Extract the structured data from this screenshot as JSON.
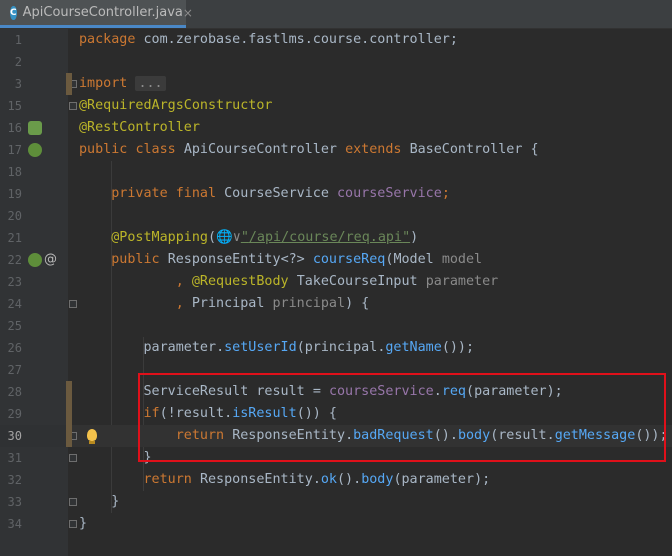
{
  "tab": {
    "icon_letter": "C",
    "file_name": "ApiCourseController.java",
    "close_symbol": "×"
  },
  "lines": [
    {
      "num": "1",
      "tokens": [
        {
          "t": "package ",
          "c": "kw"
        },
        {
          "t": "com.zerobase.fastlms.course.controller;",
          "c": "plain"
        }
      ]
    },
    {
      "num": "2",
      "tokens": []
    },
    {
      "num": "3",
      "tokens": [
        {
          "t": "import ",
          "c": "kw"
        },
        {
          "t": "...",
          "c": "fold-collapsed"
        }
      ]
    },
    {
      "num": "15",
      "tokens": [
        {
          "t": "@RequiredArgsConstructor",
          "c": "ann"
        }
      ]
    },
    {
      "num": "16",
      "tokens": [
        {
          "t": "@RestController",
          "c": "ann"
        }
      ]
    },
    {
      "num": "17",
      "tokens": [
        {
          "t": "public ",
          "c": "kw"
        },
        {
          "t": "class ",
          "c": "kw"
        },
        {
          "t": "ApiCourseController ",
          "c": "plain"
        },
        {
          "t": "extends ",
          "c": "kw"
        },
        {
          "t": "BaseController ",
          "c": "plain"
        },
        {
          "t": "{",
          "c": "plain"
        }
      ]
    },
    {
      "num": "18",
      "tokens": []
    },
    {
      "num": "19",
      "tokens": [
        {
          "t": "    private ",
          "c": "kw"
        },
        {
          "t": "final ",
          "c": "kw"
        },
        {
          "t": "CourseService ",
          "c": "plain"
        },
        {
          "t": "courseService",
          "c": "field"
        },
        {
          "t": ";",
          "c": "kw"
        }
      ]
    },
    {
      "num": "20",
      "tokens": []
    },
    {
      "num": "21",
      "tokens": [
        {
          "t": "    @PostMapping",
          "c": "ann"
        },
        {
          "t": "(",
          "c": "plain"
        },
        {
          "t": "🌐∨",
          "c": "grayparam"
        },
        {
          "t": "\"",
          "c": "str"
        },
        {
          "t": "/api/course/req.api",
          "c": "str"
        },
        {
          "t": "\"",
          "c": "str"
        },
        {
          "t": ")",
          "c": "plain"
        }
      ]
    },
    {
      "num": "22",
      "tokens": [
        {
          "t": "    public ",
          "c": "kw"
        },
        {
          "t": "ResponseEntity",
          "c": "plain"
        },
        {
          "t": "<?> ",
          "c": "plain"
        },
        {
          "t": "courseReq",
          "c": "methodcall"
        },
        {
          "t": "(",
          "c": "plain"
        },
        {
          "t": "Model ",
          "c": "plain"
        },
        {
          "t": "model",
          "c": "grayparam"
        }
      ]
    },
    {
      "num": "23",
      "tokens": [
        {
          "t": "            , ",
          "c": "kw"
        },
        {
          "t": "@RequestBody ",
          "c": "ann"
        },
        {
          "t": "TakeCourseInput ",
          "c": "plain"
        },
        {
          "t": "parameter",
          "c": "grayparam"
        }
      ]
    },
    {
      "num": "24",
      "tokens": [
        {
          "t": "            , ",
          "c": "kw"
        },
        {
          "t": "Principal ",
          "c": "plain"
        },
        {
          "t": "principal",
          "c": "grayparam"
        },
        {
          "t": ") {",
          "c": "plain"
        }
      ]
    },
    {
      "num": "25",
      "tokens": []
    },
    {
      "num": "26",
      "tokens": [
        {
          "t": "        parameter",
          "c": "plain"
        },
        {
          "t": ".",
          "c": "plain"
        },
        {
          "t": "setUserId",
          "c": "methodcall"
        },
        {
          "t": "(",
          "c": "plain"
        },
        {
          "t": "principal",
          "c": "plain"
        },
        {
          "t": ".",
          "c": "plain"
        },
        {
          "t": "getName",
          "c": "methodcall"
        },
        {
          "t": "());",
          "c": "plain"
        }
      ]
    },
    {
      "num": "27",
      "tokens": []
    },
    {
      "num": "28",
      "tokens": [
        {
          "t": "        ServiceResult ",
          "c": "plain"
        },
        {
          "t": "result ",
          "c": "plain"
        },
        {
          "t": "= ",
          "c": "plain"
        },
        {
          "t": "courseService",
          "c": "field"
        },
        {
          "t": ".",
          "c": "plain"
        },
        {
          "t": "req",
          "c": "methodcall"
        },
        {
          "t": "(",
          "c": "plain"
        },
        {
          "t": "parameter",
          "c": "plain"
        },
        {
          "t": ");",
          "c": "plain"
        }
      ]
    },
    {
      "num": "29",
      "tokens": [
        {
          "t": "        if",
          "c": "kw"
        },
        {
          "t": "(!",
          "c": "plain"
        },
        {
          "t": "result",
          "c": "plain"
        },
        {
          "t": ".",
          "c": "plain"
        },
        {
          "t": "isResult",
          "c": "methodcall"
        },
        {
          "t": "()) {",
          "c": "plain"
        }
      ]
    },
    {
      "num": "30",
      "tokens": [
        {
          "t": "            return ",
          "c": "kw"
        },
        {
          "t": "ResponseEntity",
          "c": "plain"
        },
        {
          "t": ".",
          "c": "plain"
        },
        {
          "t": "badRequest",
          "c": "methodcall"
        },
        {
          "t": "().",
          "c": "plain"
        },
        {
          "t": "body",
          "c": "methodcall"
        },
        {
          "t": "(",
          "c": "plain"
        },
        {
          "t": "result",
          "c": "plain"
        },
        {
          "t": ".",
          "c": "plain"
        },
        {
          "t": "getMessage",
          "c": "methodcall"
        },
        {
          "t": "());",
          "c": "plain"
        }
      ]
    },
    {
      "num": "31",
      "tokens": [
        {
          "t": "        }",
          "c": "plain"
        }
      ]
    },
    {
      "num": "32",
      "tokens": [
        {
          "t": "        return ",
          "c": "kw"
        },
        {
          "t": "ResponseEntity",
          "c": "plain"
        },
        {
          "t": ".",
          "c": "plain"
        },
        {
          "t": "ok",
          "c": "methodcall"
        },
        {
          "t": "().",
          "c": "plain"
        },
        {
          "t": "body",
          "c": "methodcall"
        },
        {
          "t": "(",
          "c": "plain"
        },
        {
          "t": "parameter",
          "c": "plain"
        },
        {
          "t": ");",
          "c": "plain"
        }
      ]
    },
    {
      "num": "33",
      "tokens": [
        {
          "t": "    }",
          "c": "plain"
        }
      ]
    },
    {
      "num": "34",
      "tokens": [
        {
          "t": "}",
          "c": "plain"
        }
      ]
    }
  ],
  "current_line": "30",
  "gutter_icons": {
    "spring_bean_icon": "spring-bean-icon",
    "spring_run_icon": "spring-run-icon",
    "at_symbol": "@",
    "bulb_icon": "lightbulb-icon"
  },
  "colors": {
    "keyword": "#cc7832",
    "annotation": "#bbb529",
    "string": "#6a8759",
    "field": "#9876aa",
    "method": "#56a8f5",
    "highlight_box": "#e0101a"
  }
}
